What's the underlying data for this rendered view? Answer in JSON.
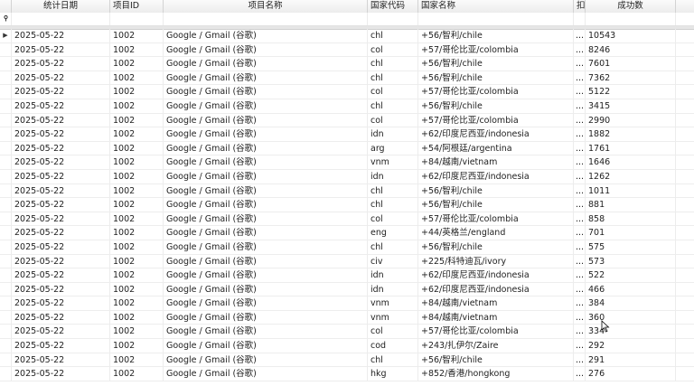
{
  "columns": [
    "统计日期",
    "项目ID",
    "项目名称",
    "国家代码",
    "国家名称",
    "扣",
    "成功数"
  ],
  "filter_row_icon": "filter-pin-icon",
  "current_row_icon": "row-pointer-icon",
  "rows": [
    {
      "date": "2025-05-22",
      "pid": "1002",
      "pname": "Google / Gmail (谷歌)",
      "code": "chl",
      "country": "+56/智利/chile",
      "x": "...",
      "count": "10543"
    },
    {
      "date": "2025-05-22",
      "pid": "1002",
      "pname": "Google / Gmail (谷歌)",
      "code": "col",
      "country": "+57/哥伦比亚/colombia",
      "x": "...",
      "count": "8246"
    },
    {
      "date": "2025-05-22",
      "pid": "1002",
      "pname": "Google / Gmail (谷歌)",
      "code": "chl",
      "country": "+56/智利/chile",
      "x": "...",
      "count": "7601"
    },
    {
      "date": "2025-05-22",
      "pid": "1002",
      "pname": "Google / Gmail (谷歌)",
      "code": "chl",
      "country": "+56/智利/chile",
      "x": "...",
      "count": "7362"
    },
    {
      "date": "2025-05-22",
      "pid": "1002",
      "pname": "Google / Gmail (谷歌)",
      "code": "col",
      "country": "+57/哥伦比亚/colombia",
      "x": "...",
      "count": "5122"
    },
    {
      "date": "2025-05-22",
      "pid": "1002",
      "pname": "Google / Gmail (谷歌)",
      "code": "chl",
      "country": "+56/智利/chile",
      "x": "...",
      "count": "3415"
    },
    {
      "date": "2025-05-22",
      "pid": "1002",
      "pname": "Google / Gmail (谷歌)",
      "code": "col",
      "country": "+57/哥伦比亚/colombia",
      "x": "...",
      "count": "2990"
    },
    {
      "date": "2025-05-22",
      "pid": "1002",
      "pname": "Google / Gmail (谷歌)",
      "code": "idn",
      "country": "+62/印度尼西亚/indonesia",
      "x": "...",
      "count": "1882"
    },
    {
      "date": "2025-05-22",
      "pid": "1002",
      "pname": "Google / Gmail (谷歌)",
      "code": "arg",
      "country": "+54/阿根廷/argentina",
      "x": "...",
      "count": "1761"
    },
    {
      "date": "2025-05-22",
      "pid": "1002",
      "pname": "Google / Gmail (谷歌)",
      "code": "vnm",
      "country": "+84/越南/vietnam",
      "x": "...",
      "count": "1646"
    },
    {
      "date": "2025-05-22",
      "pid": "1002",
      "pname": "Google / Gmail (谷歌)",
      "code": "idn",
      "country": "+62/印度尼西亚/indonesia",
      "x": "...",
      "count": "1262"
    },
    {
      "date": "2025-05-22",
      "pid": "1002",
      "pname": "Google / Gmail (谷歌)",
      "code": "chl",
      "country": "+56/智利/chile",
      "x": "...",
      "count": "1011"
    },
    {
      "date": "2025-05-22",
      "pid": "1002",
      "pname": "Google / Gmail (谷歌)",
      "code": "chl",
      "country": "+56/智利/chile",
      "x": "...",
      "count": "881"
    },
    {
      "date": "2025-05-22",
      "pid": "1002",
      "pname": "Google / Gmail (谷歌)",
      "code": "col",
      "country": "+57/哥伦比亚/colombia",
      "x": "...",
      "count": "858"
    },
    {
      "date": "2025-05-22",
      "pid": "1002",
      "pname": "Google / Gmail (谷歌)",
      "code": "eng",
      "country": "+44/英格兰/england",
      "x": "...",
      "count": "701"
    },
    {
      "date": "2025-05-22",
      "pid": "1002",
      "pname": "Google / Gmail (谷歌)",
      "code": "chl",
      "country": "+56/智利/chile",
      "x": "...",
      "count": "575"
    },
    {
      "date": "2025-05-22",
      "pid": "1002",
      "pname": "Google / Gmail (谷歌)",
      "code": "civ",
      "country": "+225/科特迪瓦/ivory",
      "x": "...",
      "count": "573"
    },
    {
      "date": "2025-05-22",
      "pid": "1002",
      "pname": "Google / Gmail (谷歌)",
      "code": "idn",
      "country": "+62/印度尼西亚/indonesia",
      "x": "...",
      "count": "522"
    },
    {
      "date": "2025-05-22",
      "pid": "1002",
      "pname": "Google / Gmail (谷歌)",
      "code": "idn",
      "country": "+62/印度尼西亚/indonesia",
      "x": "...",
      "count": "466"
    },
    {
      "date": "2025-05-22",
      "pid": "1002",
      "pname": "Google / Gmail (谷歌)",
      "code": "vnm",
      "country": "+84/越南/vietnam",
      "x": "...",
      "count": "384"
    },
    {
      "date": "2025-05-22",
      "pid": "1002",
      "pname": "Google / Gmail (谷歌)",
      "code": "vnm",
      "country": "+84/越南/vietnam",
      "x": "...",
      "count": "360"
    },
    {
      "date": "2025-05-22",
      "pid": "1002",
      "pname": "Google / Gmail (谷歌)",
      "code": "col",
      "country": "+57/哥伦比亚/colombia",
      "x": "...",
      "count": "334"
    },
    {
      "date": "2025-05-22",
      "pid": "1002",
      "pname": "Google / Gmail (谷歌)",
      "code": "cod",
      "country": "+243/扎伊尔/Zaire",
      "x": "...",
      "count": "292"
    },
    {
      "date": "2025-05-22",
      "pid": "1002",
      "pname": "Google / Gmail (谷歌)",
      "code": "chl",
      "country": "+56/智利/chile",
      "x": "...",
      "count": "291"
    },
    {
      "date": "2025-05-22",
      "pid": "1002",
      "pname": "Google / Gmail (谷歌)",
      "code": "hkg",
      "country": "+852/香港/hongkong",
      "x": "...",
      "count": "276"
    }
  ]
}
